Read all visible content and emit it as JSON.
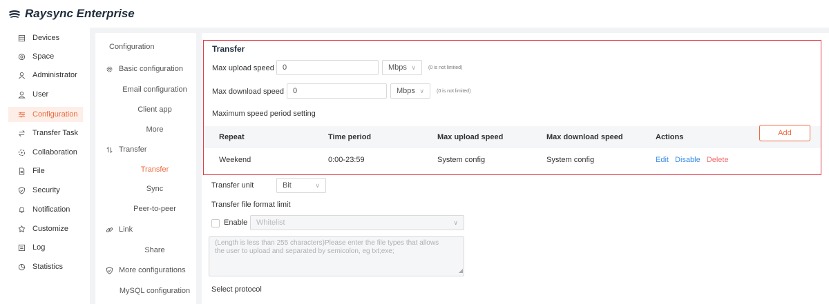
{
  "app": {
    "title": "Raysync Enterprise"
  },
  "sidebar": {
    "items": [
      {
        "label": "Devices",
        "icon": "devices-icon"
      },
      {
        "label": "Space",
        "icon": "space-icon"
      },
      {
        "label": "Administrator",
        "icon": "administrator-icon"
      },
      {
        "label": "User",
        "icon": "user-icon"
      },
      {
        "label": "Configuration",
        "icon": "configuration-icon",
        "active": true
      },
      {
        "label": "Transfer Task",
        "icon": "transfer-task-icon"
      },
      {
        "label": "Collaboration",
        "icon": "collaboration-icon"
      },
      {
        "label": "File",
        "icon": "file-icon"
      },
      {
        "label": "Security",
        "icon": "security-icon"
      },
      {
        "label": "Notification",
        "icon": "notification-icon"
      },
      {
        "label": "Customize",
        "icon": "customize-icon"
      },
      {
        "label": "Log",
        "icon": "log-icon"
      },
      {
        "label": "Statistics",
        "icon": "statistics-icon"
      }
    ]
  },
  "subnav": {
    "header": "Configuration",
    "basic_configuration": "Basic configuration",
    "email_configuration": "Email configuration",
    "client_app": "Client app",
    "more": "More",
    "transfer_group": "Transfer",
    "transfer": "Transfer",
    "sync": "Sync",
    "peer_to_peer": "Peer-to-peer",
    "link_group": "Link",
    "share": "Share",
    "more_configurations": "More configurations",
    "mysql_configuration": "MySQL configuration"
  },
  "transfer": {
    "title": "Transfer",
    "max_upload_label": "Max upload speed",
    "max_upload_value": "0",
    "max_upload_unit": "Mbps",
    "max_upload_hint": "(0 is not limited)",
    "max_download_label": "Max download speed",
    "max_download_value": "0",
    "max_download_unit": "Mbps",
    "max_download_hint": "(0 is not limited)",
    "period_setting_label": "Maximum speed period setting",
    "add_label": "Add",
    "table": {
      "headers": [
        "Repeat",
        "Time period",
        "Max upload speed",
        "Max download speed",
        "Actions"
      ],
      "rows": [
        {
          "repeat": "Weekend",
          "time_period": "0:00-23:59",
          "max_upload": "System config",
          "max_download": "System config"
        }
      ],
      "actions": {
        "edit": "Edit",
        "disable": "Disable",
        "delete": "Delete"
      }
    }
  },
  "transfer_unit": {
    "label": "Transfer unit",
    "value": "Bit"
  },
  "format_limit": {
    "label": "Transfer file format limit",
    "enable_label": "Enable",
    "list_value": "Whitelist",
    "placeholder_line1": "(Length is less than 255 characters)Please enter the file types that allows",
    "placeholder_line2": "the user to upload and separated by semicolon, eg txt;exe;"
  },
  "protocol": {
    "label": "Select protocol"
  },
  "colors": {
    "accent": "#ec6a3d",
    "highlight_border": "#e23d4a",
    "link": "#3a8ee6",
    "danger": "#f56c6c"
  }
}
